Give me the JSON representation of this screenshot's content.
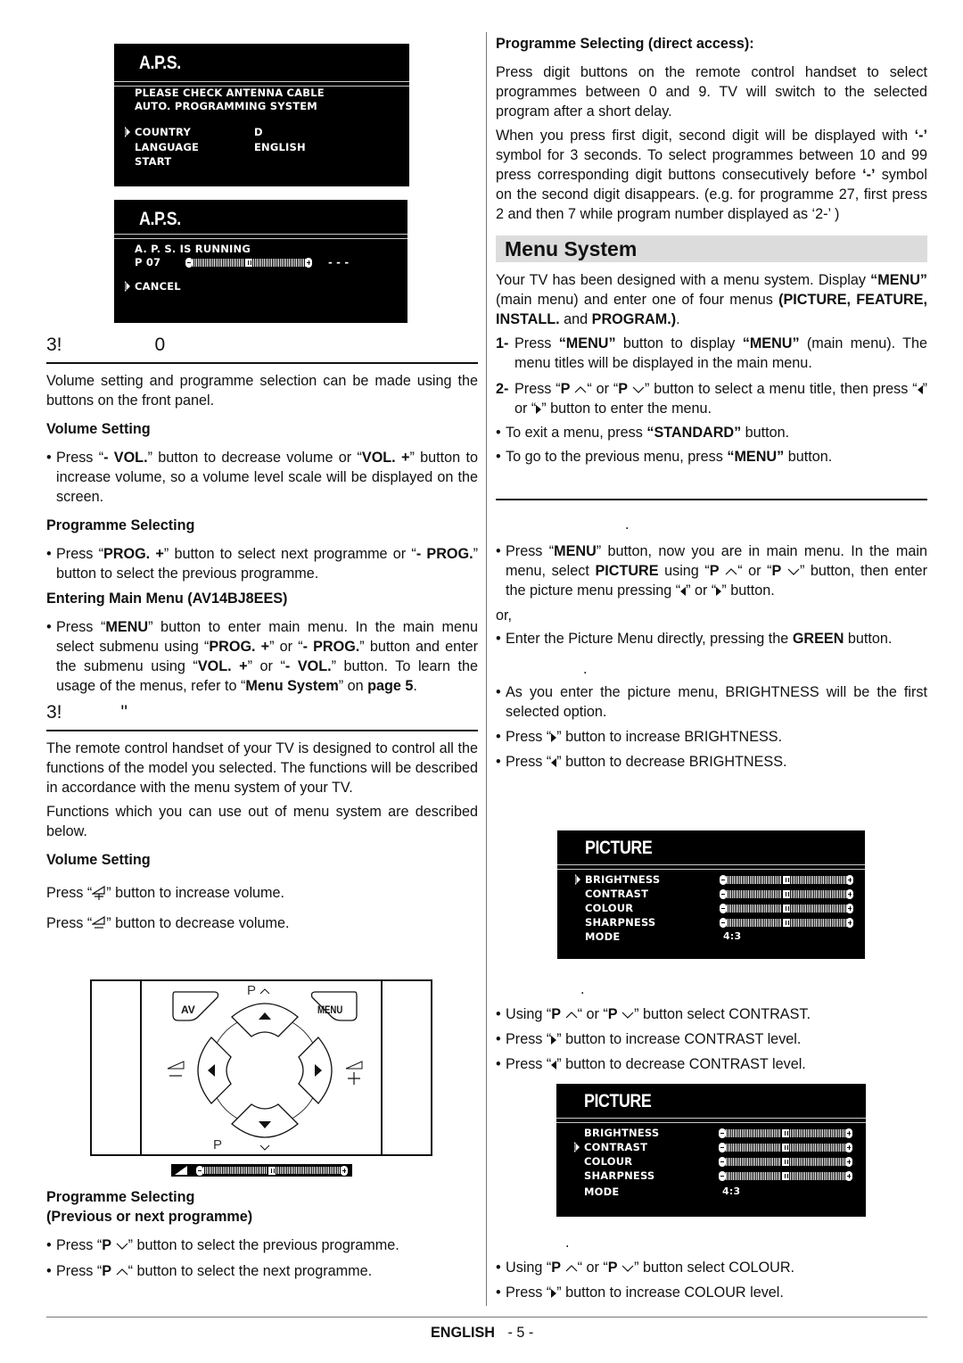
{
  "aps_screen_1": {
    "title": "A.P.S.",
    "lines": [
      "PLEASE  CHECK  ANTENNA  CABLE",
      "AUTO.  PROGRAMMING  SYSTEM"
    ],
    "items": [
      {
        "label": "COUNTRY",
        "value": "D",
        "selected": true
      },
      {
        "label": "LANGUAGE",
        "value": "ENGLISH",
        "selected": false
      },
      {
        "label": "START",
        "value": "",
        "selected": false
      }
    ]
  },
  "aps_screen_2": {
    "title": "A.P.S.",
    "status": "A.  P.  S.  IS  RUNNING",
    "programme": "P  07",
    "progress_level": 0.5,
    "channel_readout": "- - -",
    "cancel_label": "CANCEL"
  },
  "left": {
    "section1_heading": [
      "3!",
      "0"
    ],
    "intro": "Volume setting and programme selection can be made using the buttons on the front panel.",
    "volume_heading": "Volume Setting",
    "volume_bullet": {
      "t1": "Press “",
      "b1": "- VOL.",
      "t2": "” button to decrease volume or “",
      "b2": "VOL. +",
      "t3": "” button to increase volume, so a volume level scale will be displayed on the screen."
    },
    "prog_heading": "Programme Selecting",
    "prog_bullet": {
      "t1": "Press “",
      "b1": "PROG. +",
      "t2": "” button to select next programme or “",
      "b2": "- PROG.",
      "t3": "” button to select the previous programme."
    },
    "menu_heading": "Entering Main Menu (AV14BJ8EES)",
    "menu_bullet": {
      "t1": "Press “",
      "b1": "MENU",
      "t2": "” button to enter main menu. In the main menu select submenu using “",
      "b2": "PROG. +",
      "t3": "” or “",
      "b3": "- PROG.",
      "t4": "” button and enter the submenu using “",
      "b4": "VOL. +",
      "t5": "” or “",
      "b5": "- VOL.",
      "t6": "”  button. To learn the usage of the menus, refer to “",
      "b6": "Menu System",
      "t7": "” on ",
      "b7": "page 5",
      "t8": "."
    },
    "section2_heading": [
      "3!",
      "\""
    ],
    "remote_p1": "The remote control handset of your TV is designed to control all the functions of the model you selected. The functions will be described  in accordance with the menu system of your TV.",
    "remote_p2": "Functions which you can use out of menu system are described below.",
    "volume2_heading": "Volume Setting",
    "vol_up": {
      "t1": "Press “",
      "t2": "” button to increase volume."
    },
    "vol_down": {
      "t1": "Press “",
      "t2": "”  button  to decrease volume."
    },
    "panel": {
      "p_up_label": "P",
      "p_down_label": "P",
      "av_label": "AV",
      "menu_label": "MENU",
      "volume_level": 0.5
    },
    "prog2_heading_1": "Programme Selecting",
    "prog2_heading_2": "(Previous or next programme)",
    "prev_bullet": {
      "t1": "Press “",
      "b1": "P",
      "t2": "” button to select the previous programme."
    },
    "next_bullet": {
      "t1": "Press “",
      "b1": "P",
      "t2": "“ button to select the next programme."
    }
  },
  "right": {
    "direct_heading": "Programme Selecting (direct access):",
    "direct_p1": "Press digit buttons on the remote control handset to select programmes between 0 and 9. TV will switch to the selected program after a short delay.",
    "direct_p2": {
      "t1": "When you press first digit, second digit will be displayed with ",
      "b1": "‘-’",
      "t2": " symbol for 3 seconds. To select programmes between 10 and 99 press corresponding digit buttons consecutively before ",
      "b2": "‘-’",
      "t3": " symbol on the second digit disappears. (e.g. for programme 27, first press 2 and then 7 while program number displayed as ‘2-’ )"
    },
    "menu_system_title": "Menu System",
    "menu_intro": {
      "t1": "Your TV has been designed with a menu system. Display ",
      "b1": "“MENU”",
      "t2": " (main menu) and enter one of four menus ",
      "b2": "(PICTURE, FEATURE, INSTALL.",
      "t3": " and ",
      "b3": "PROGRAM.)",
      "t4": "."
    },
    "step1": {
      "n": "1-",
      "t1": " Press ",
      "b1": "“MENU”",
      "t2": " button to display ",
      "b2": "“MENU”",
      "t3": " (main menu). The menu titles will be displayed in the main menu."
    },
    "step2": {
      "n": "2-",
      "t1": " Press “",
      "b1": "P",
      "t2": "“ or “",
      "b2": "P",
      "t3": "” button to select a menu title, then press “",
      "t4": "” or “",
      "t5": "” button to enter the menu."
    },
    "exit_bullet": {
      "t1": "To exit a menu, press ",
      "b1": "“STANDARD”",
      "t2": " button."
    },
    "prev_bullet": {
      "t1": "To go to the previous menu, press ",
      "b1": "“MENU”",
      "t2": " button."
    },
    "dot": ".",
    "pic_bullet1": {
      "t1": "Press “",
      "b1": "MENU",
      "t2": "” button, now you are in main menu. In the main menu, select ",
      "b2": "PICTURE",
      "t3": " using “",
      "b3": "P",
      "t4": "“ or “",
      "b4": "P",
      "t5": "” button, then enter the picture menu pressing “",
      "t6": "” or “",
      "t7": "” button."
    },
    "or_label": "or,",
    "pic_bullet2": {
      "t1": "Enter the Picture Menu directly, pressing the ",
      "b1": "GREEN",
      "t2": " button."
    },
    "bright_b1": "As you enter the picture menu, BRIGHTNESS will be the first selected option.",
    "bright_b2": {
      "t1": "Press “",
      "t2": "” button to increase BRIGHTNESS."
    },
    "bright_b3": {
      "t1": "Press “",
      "t2": "” button  to decrease BRIGHTNESS."
    },
    "contrast_b1": {
      "t1": "Using “",
      "b1": "P",
      "t2": "“ or “",
      "b2": "P",
      "t3": "” button select CONTRAST."
    },
    "contrast_b2": {
      "t1": "Press “",
      "t2": "” button to increase CONTRAST level."
    },
    "contrast_b3": {
      "t1": "Press “",
      "t2": "” button to decrease CONTRAST level."
    },
    "colour_b1": {
      "t1": "Using “",
      "b1": "P",
      "t2": "“ or “",
      "b2": "P",
      "t3": "” button select COLOUR."
    },
    "colour_b2": {
      "t1": "Press “",
      "t2": "” button to increase COLOUR level."
    }
  },
  "picture_menu_1": {
    "title": "PICTURE",
    "items": [
      {
        "label": "BRIGHTNESS",
        "level": 0.5,
        "selected": true
      },
      {
        "label": "CONTRAST",
        "level": 0.5,
        "selected": false
      },
      {
        "label": "COLOUR",
        "level": 0.5,
        "selected": false
      },
      {
        "label": "SHARPNESS",
        "level": 0.5,
        "selected": false
      }
    ],
    "mode_label": "MODE",
    "mode_value": "4:3"
  },
  "picture_menu_2": {
    "title": "PICTURE",
    "items": [
      {
        "label": "BRIGHTNESS",
        "level": 0.5,
        "selected": false
      },
      {
        "label": "CONTRAST",
        "level": 0.5,
        "selected": true
      },
      {
        "label": "COLOUR",
        "level": 0.5,
        "selected": false
      },
      {
        "label": "SHARPNESS",
        "level": 0.5,
        "selected": false
      }
    ],
    "mode_label": "MODE",
    "mode_value": "4:3"
  },
  "footer": {
    "language": "ENGLISH",
    "page": "- 5 -"
  }
}
